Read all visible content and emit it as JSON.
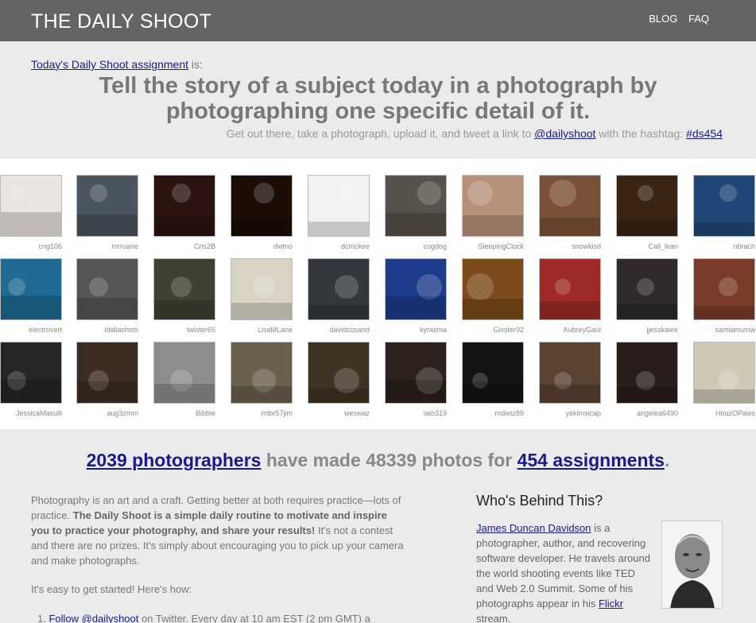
{
  "header": {
    "title": "THE DAILY SHOOT",
    "nav": [
      "BLOG",
      "FAQ"
    ]
  },
  "assignment": {
    "link_text": "Today's Daily Shoot assignment",
    "link_suffix": " is:",
    "text": "Tell the story of a subject today in a photograph by photographing one specific detail of it.",
    "sub_prefix": "Get out there, take a photograph, upload it, and tweet a link to ",
    "sub_handle": "@dailyshoot",
    "sub_middle": " with the hashtag: ",
    "sub_hashtag": "#ds454"
  },
  "gallery": [
    [
      "cng106",
      "mrruane",
      "Cris2B",
      "dwtno",
      "dcmckee",
      "cogdog",
      "SleepingClock",
      "snowkisd",
      "Call_lean",
      "nbrach"
    ],
    [
      "electrovert",
      "idaliashots",
      "twister65",
      "LisaMLane",
      "davidcosand",
      "kyrasma",
      "Gixster92",
      "AubreyGaul",
      "jjesskalee",
      "samiamumw"
    ],
    [
      "JessicaMasulli",
      "aug3zmm",
      "Bibble",
      "mtbr57jim",
      "weswaz",
      "lalo319",
      "mdietz89",
      "yekimsicap",
      "angelea6490",
      "HouzOPaws"
    ]
  ],
  "thumb_colors": [
    [
      "#e9e5e0",
      "#4a5560",
      "#2b1410",
      "#1c0e06",
      "#f2f2f2",
      "#57524a",
      "#b8917b",
      "#7a5138",
      "#3a2514",
      "#1f4677"
    ],
    [
      "#1f6b94",
      "#565656",
      "#3e4233",
      "#d8d3c4",
      "#34383c",
      "#1d3c8c",
      "#7e4b1c",
      "#9e2b25",
      "#2e2a2e",
      "#7a3c2a"
    ],
    [
      "#262626",
      "#3b2d21",
      "#8c8e8c",
      "#6b604e",
      "#3f3424",
      "#2e211c",
      "#141414",
      "#5b4332",
      "#2a1e1c",
      "#cfc8b7"
    ]
  ],
  "stats": {
    "photographers": "2039 photographers",
    "middle": " have made 48339 photos for ",
    "assignments": "454 assignments",
    "end": "."
  },
  "intro": {
    "p1_start": "Photography is an art and a craft. Getting better at both requires practice—lots of practice. ",
    "p1_bold": "The Daily Shoot is a simple daily routine to motivate and inspire you to practice your photography, and share your results!",
    "p1_end": " It's not a contest and there are no prizes. It's simply about encouraging you to pick up your camera and make photographs.",
    "p2": "It's easy to get started! Here's how:",
    "step1_num": "1. ",
    "step1_link": "Follow @dailyshoot",
    "step1_rest": " on Twitter. Every day at 10 am EST (2 pm GMT) a"
  },
  "who": {
    "title": "Who's Behind This?",
    "name": "James Duncan Davidson",
    "text": " is a photographer, author, and recovering software developer. He travels around the world shooting events like TED and Web 2.0 Summit. Some of his photographs appear in his ",
    "flickr": "Flickr",
    "text_end": " stream."
  }
}
